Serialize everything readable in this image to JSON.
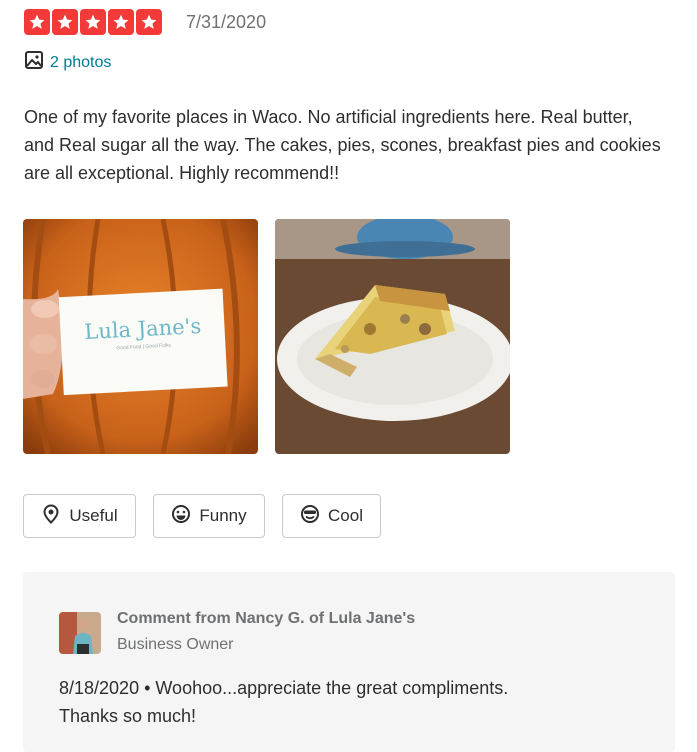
{
  "review": {
    "rating": 5,
    "max_rating": 5,
    "date": "7/31/2020",
    "photos_link": "2 photos",
    "text": "One of my favorite places in Waco. No artificial ingredients here. Real butter, and Real sugar all the way. The cakes, pies, scones, breakfast pies and cookies are all exceptional. Highly recommend!!",
    "photos": [
      {
        "card_title": "Lula Jane's",
        "card_subtitle": "Good Food | Good Folks"
      },
      {}
    ]
  },
  "reactions": [
    {
      "label": "Useful",
      "icon": "useful-icon"
    },
    {
      "label": "Funny",
      "icon": "funny-icon"
    },
    {
      "label": "Cool",
      "icon": "cool-icon"
    }
  ],
  "owner_comment": {
    "title": "Comment from Nancy G. of Lula Jane's",
    "role": "Business Owner",
    "date": "8/18/2020",
    "separator": " • ",
    "text": "Woohoo...appreciate the great compliments.\n Thanks so much!"
  },
  "colors": {
    "star_red": "#f43939",
    "link_teal": "#027a97",
    "comment_bg": "#f5f5f5"
  }
}
